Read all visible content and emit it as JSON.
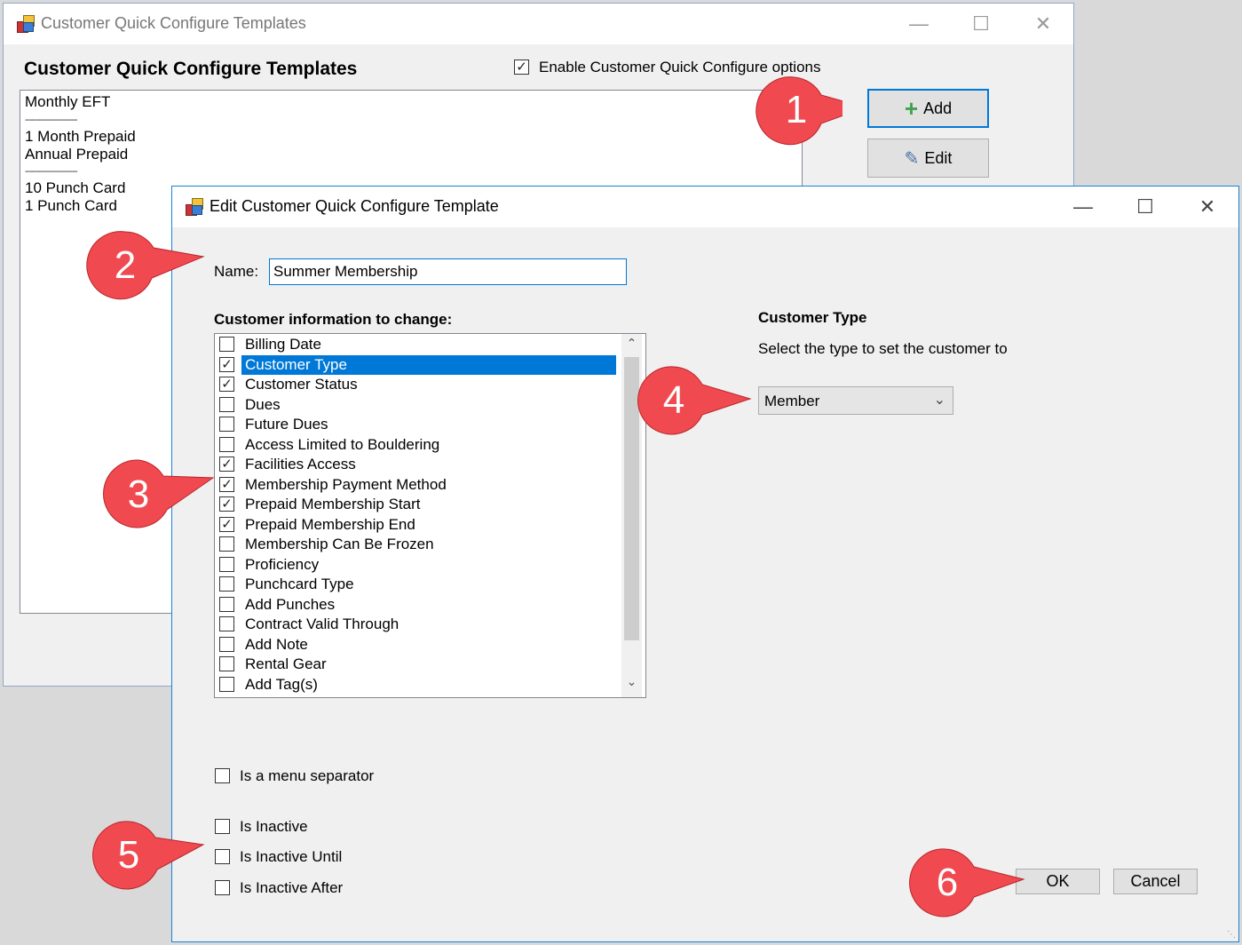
{
  "main_window": {
    "title": "Customer Quick Configure Templates",
    "heading": "Customer Quick Configure Templates",
    "enable_label": "Enable Customer Quick Configure options",
    "enable_checked": true,
    "templates": [
      "Monthly EFT",
      "----------------------",
      "1 Month Prepaid",
      "Annual Prepaid",
      "----------------------",
      "10 Punch Card",
      "1 Punch Card"
    ],
    "add_label": "Add",
    "edit_label": "Edit"
  },
  "dialog": {
    "title": "Edit Customer Quick Configure Template",
    "name_label": "Name:",
    "name_value": "Summer Membership",
    "info_heading": "Customer information to change:",
    "items": [
      {
        "label": "Billing Date",
        "checked": false
      },
      {
        "label": "Customer Type",
        "checked": true,
        "selected": true
      },
      {
        "label": "Customer Status",
        "checked": true
      },
      {
        "label": "Dues",
        "checked": false
      },
      {
        "label": "Future Dues",
        "checked": false
      },
      {
        "label": "Access Limited to Bouldering",
        "checked": false
      },
      {
        "label": "Facilities  Access",
        "checked": true
      },
      {
        "label": "Membership Payment Method",
        "checked": true
      },
      {
        "label": "Prepaid Membership Start",
        "checked": true
      },
      {
        "label": "Prepaid Membership End",
        "checked": true
      },
      {
        "label": "Membership Can Be Frozen",
        "checked": false
      },
      {
        "label": "Proficiency",
        "checked": false
      },
      {
        "label": "Punchcard Type",
        "checked": false
      },
      {
        "label": "Add Punches",
        "checked": false
      },
      {
        "label": "Contract Valid Through",
        "checked": false
      },
      {
        "label": "Add Note",
        "checked": false
      },
      {
        "label": "Rental Gear",
        "checked": false
      },
      {
        "label": "Add Tag(s)",
        "checked": false
      }
    ],
    "customer_type_heading": "Customer Type",
    "customer_type_desc": "Select the type to set the customer to",
    "customer_type_value": "Member",
    "menu_separator_label": "Is a menu separator",
    "inactive_label": "Is Inactive",
    "inactive_until_label": "Is Inactive Until",
    "inactive_after_label": "Is Inactive After",
    "ok_label": "OK",
    "cancel_label": "Cancel"
  },
  "callouts": [
    "1",
    "2",
    "3",
    "4",
    "5",
    "6"
  ],
  "colors": {
    "callout": "#f04a50",
    "selection": "#0078d7"
  }
}
